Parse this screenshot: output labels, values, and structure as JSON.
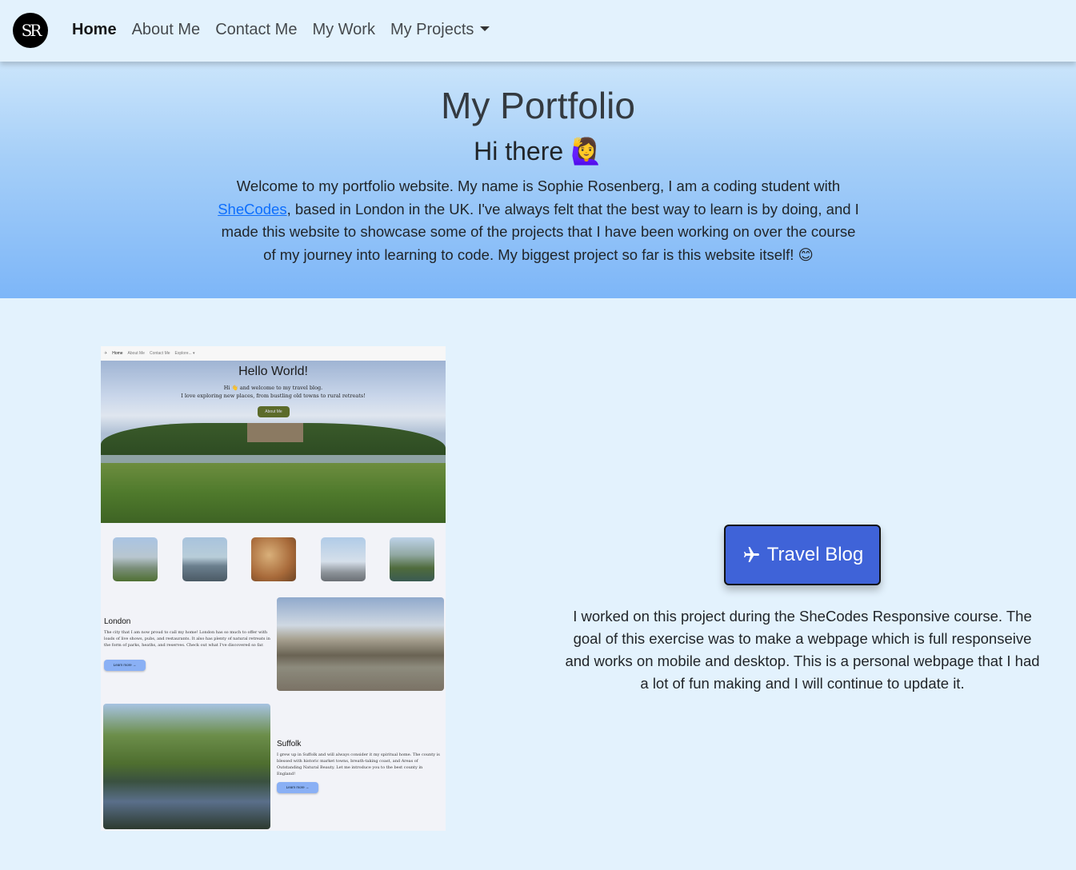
{
  "nav": {
    "logo_text": "SR",
    "links": [
      {
        "label": "Home",
        "active": true
      },
      {
        "label": "About Me"
      },
      {
        "label": "Contact Me"
      },
      {
        "label": "My Work"
      },
      {
        "label": "My Projects",
        "dropdown": true
      }
    ]
  },
  "hero": {
    "title": "My Portfolio",
    "greeting": "Hi there 🙋‍♀️",
    "intro_before_link": "Welcome to my portfolio website. My name is Sophie Rosenberg, I am a coding student with ",
    "link_text": "SheCodes",
    "intro_after_link": ", based in London in the UK. I've always felt that the best way to learn is by doing, and I made this website to showcase some of the projects that I have been working on over the course of my journey into learning to code. My biggest project so far is this website itself! 😊"
  },
  "project": {
    "preview": {
      "nav_items": [
        "✈",
        "Home",
        "About Me",
        "Contact Me",
        "Explore... ▾"
      ],
      "title": "Hello World!",
      "subtitle_line1": "Hi 👋 and welcome to my travel blog.",
      "subtitle_line2": "I love exploring new places, from bustling old towns to rural retreats!",
      "hero_button": "About Me",
      "london_title": "London",
      "london_text": "The city that I am now proud to call my home! London has so much to offer with loads of live shows, pubs, and restaurants. It also has plenty of natural retreats in the form of parks, heaths, and reserves. Check out what I've discovered so far.",
      "london_button": "Learn more →",
      "suffolk_title": "Suffolk",
      "suffolk_text": "I grew up in Suffolk and will always consider it my spiritual home. The county is blessed with historic market towns, breath-taking coast, and Areas of Outstanding Natural Beauty. Let me introduce you to the best county in England!",
      "suffolk_button": "Learn more →"
    },
    "button_label": "Travel Blog",
    "button_icon": "airplane-icon",
    "description": "I worked on this project during the SheCodes Responsive course. The goal of this exercise was to make a webpage which is full responseive and works on mobile and desktop. This is a personal webpage that I had a lot of fun making and I will continue to update it."
  },
  "colors": {
    "page_bg": "#e3f2fd",
    "hero_gradient_top": "#cbe5fb",
    "hero_gradient_bottom": "#7db6f8",
    "button_bg": "#3f63d8",
    "link": "#0d6efd"
  }
}
